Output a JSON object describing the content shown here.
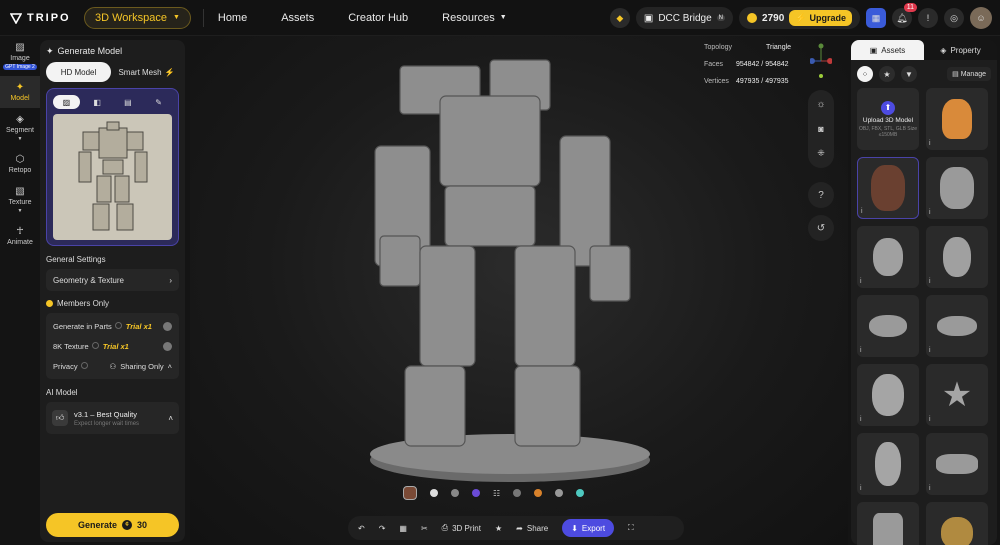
{
  "brand": {
    "name": "TRIPO"
  },
  "header": {
    "workspace": "3D Workspace",
    "nav": [
      "Home",
      "Assets",
      "Creator Hub",
      "Resources"
    ],
    "dcc_bridge": "DCC Bridge",
    "credits": "2790",
    "upgrade": "Upgrade",
    "notifications": "11"
  },
  "rail": {
    "items": [
      {
        "label": "Image",
        "badge": "GPT Image 2"
      },
      {
        "label": "Model"
      },
      {
        "label": "Segment"
      },
      {
        "label": "Retopo"
      },
      {
        "label": "Texture"
      },
      {
        "label": "Animate"
      }
    ]
  },
  "panel": {
    "title": "Generate Model",
    "mode_hd": "HD Model",
    "mode_smart": "Smart Mesh",
    "general_settings": "General Settings",
    "geometry_texture": "Geometry & Texture",
    "members_only": "Members Only",
    "gen_parts": "Generate in Parts",
    "trial1": "Trial x1",
    "tex8k": "8K Texture",
    "trial2": "Trial x1",
    "privacy": "Privacy",
    "privacy_value": "Sharing Only",
    "ai_model": "AI Model",
    "ai_version": "v3.1 – Best Quality",
    "ai_note": "Expect longer wait times",
    "generate": "Generate",
    "generate_cost": "30"
  },
  "viewport": {
    "topology_label": "Topology",
    "topology_value": "Triangle",
    "faces_label": "Faces",
    "faces_value": "954842 / 954842",
    "vertices_label": "Vertices",
    "vertices_value": "497935 / 497935",
    "help": "?",
    "print": "3D Print",
    "share": "Share",
    "export": "Export"
  },
  "right": {
    "tab_assets": "Assets",
    "tab_property": "Property",
    "manage": "Manage",
    "upload_title": "Upload 3D Model",
    "upload_sub": "OBJ, FBX, STL, GLB Size ≤150MB"
  },
  "colors": {
    "accent": "#f5c526",
    "purple": "#4d4be0"
  }
}
